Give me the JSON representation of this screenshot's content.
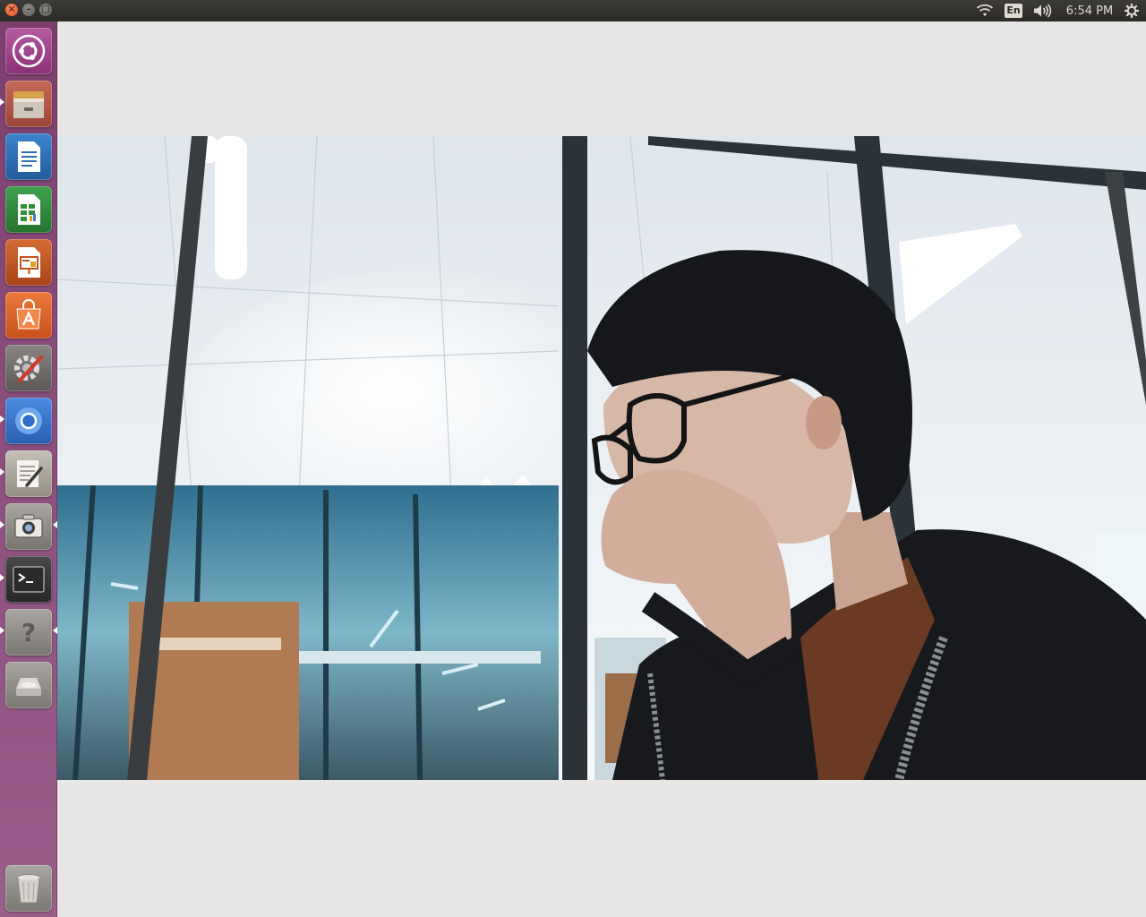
{
  "top_panel": {
    "window_controls": {
      "close_glyph": "×",
      "minimize_glyph": "–",
      "maximize_glyph": "□"
    },
    "indicators": {
      "wifi_icon": "wifi-icon",
      "keyboard_language": "En",
      "sound_icon": "speaker-icon",
      "clock": "6:54 PM",
      "session_icon": "gear-icon"
    }
  },
  "launcher": {
    "background_color": "#8a4d7c",
    "items": [
      {
        "name": "dash-home",
        "icon": "ubuntu-logo-icon",
        "color": "#9b3d8a"
      },
      {
        "name": "files",
        "icon": "file-cabinet-icon",
        "color": "#b4574a",
        "running": true
      },
      {
        "name": "libreoffice-writer",
        "icon": "document-icon",
        "color": "#2d6db3"
      },
      {
        "name": "libreoffice-calc",
        "icon": "spreadsheet-icon",
        "color": "#2f8f3b"
      },
      {
        "name": "libreoffice-impress",
        "icon": "presentation-icon",
        "color": "#c3531e"
      },
      {
        "name": "ubuntu-software",
        "icon": "shopping-bag-icon",
        "color": "#e2621e"
      },
      {
        "name": "system-settings",
        "icon": "settings-wrench-icon",
        "color": "#6f6b6a"
      },
      {
        "name": "chromium",
        "icon": "chromium-icon",
        "color": "#3b7bd8",
        "running": true
      },
      {
        "name": "text-editor",
        "icon": "text-editor-icon",
        "color": "#a8a29a",
        "running": true
      },
      {
        "name": "cheese",
        "icon": "camera-icon",
        "color": "#8e8a85",
        "running": true,
        "focused": true
      },
      {
        "name": "terminal",
        "icon": "terminal-icon",
        "color": "#3a3a3a",
        "running": true
      },
      {
        "name": "help",
        "icon": "help-icon",
        "color": "#8e8a85",
        "running": true
      },
      {
        "name": "disk",
        "icon": "disk-drive-icon",
        "color": "#8e8a85"
      }
    ],
    "trash": {
      "icon": "trash-icon",
      "color": "#8e8a85"
    }
  },
  "content": {
    "camera_preview": "webcam-feed",
    "colors": {
      "ceiling": "#eef2f5",
      "frame_bars": "#2c3338",
      "hair": "#15171a",
      "hoodie": "#17191c",
      "tshirt": "#6a3a22",
      "skin": "#d7b7a6"
    }
  }
}
